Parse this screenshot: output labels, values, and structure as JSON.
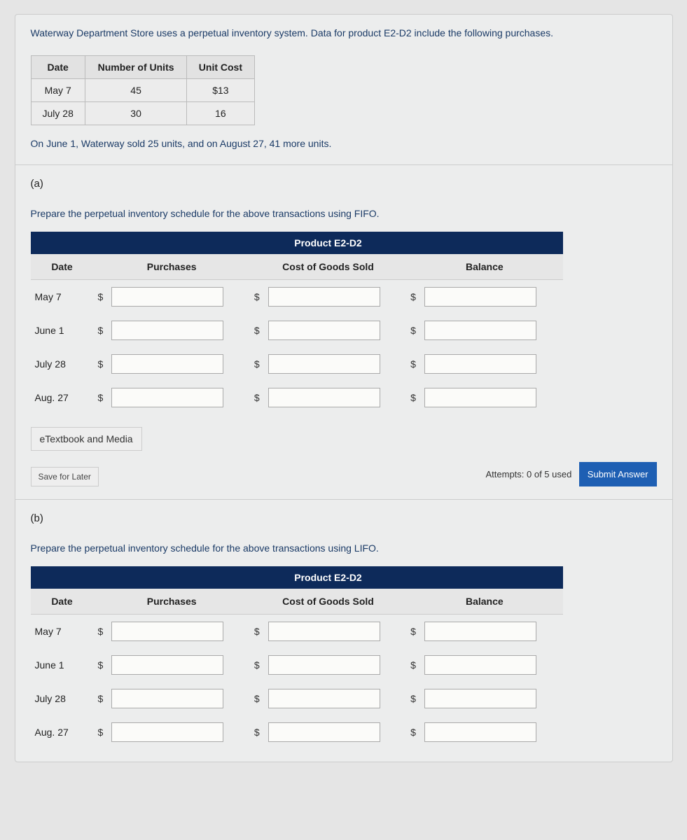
{
  "intro": "Waterway Department Store uses a perpetual inventory system. Data for product E2-D2 include the following purchases.",
  "purchTable": {
    "headers": [
      "Date",
      "Number of Units",
      "Unit Cost"
    ],
    "rows": [
      {
        "date": "May 7",
        "units": "45",
        "cost": "$13"
      },
      {
        "date": "July 28",
        "units": "30",
        "cost": "16"
      }
    ]
  },
  "saleNote": "On June 1, Waterway sold 25 units, and on August 27, 41 more units.",
  "part_a": {
    "label": "(a)",
    "prompt": "Prepare the perpetual inventory schedule for the above transactions using FIFO."
  },
  "part_b": {
    "label": "(b)",
    "prompt": "Prepare the perpetual inventory schedule for the above transactions using LIFO."
  },
  "sched": {
    "product": "Product E2-D2",
    "cols": {
      "date": "Date",
      "purch": "Purchases",
      "cogs": "Cost of Goods Sold",
      "bal": "Balance"
    },
    "dates": [
      "May 7",
      "June 1",
      "July 28",
      "Aug. 27"
    ],
    "cur": "$"
  },
  "etext": "eTextbook and Media",
  "sfl": "Save for Later",
  "attempts": "Attempts: 0 of 5 used",
  "submit": "Submit Answer"
}
